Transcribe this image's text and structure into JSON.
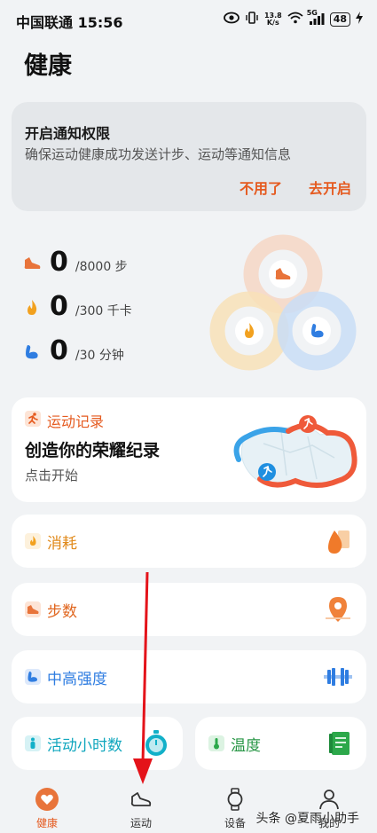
{
  "status_bar": {
    "carrier_time": "中国联通 15:56",
    "net_speed_value": "13.8",
    "net_speed_unit": "K/s",
    "signal": "5G",
    "battery": "48"
  },
  "page": {
    "title": "健康"
  },
  "notice": {
    "title": "开启通知权限",
    "description": "确保运动健康成功发送计步、运动等通知信息",
    "dismiss_label": "不用了",
    "enable_label": "去开启"
  },
  "stats": [
    {
      "icon": "shoe-icon",
      "value": "0",
      "goal": "/8000 步",
      "color": "#e8743b"
    },
    {
      "icon": "flame-icon",
      "value": "0",
      "goal": "/300 千卡",
      "color": "#f2a11f"
    },
    {
      "icon": "arm-icon",
      "value": "0",
      "goal": "/30 分钟",
      "color": "#2f7de1"
    }
  ],
  "record": {
    "tag": "运动记录",
    "title": "创造你的荣耀纪录",
    "subtitle": "点击开始"
  },
  "metrics": {
    "calories": "消耗",
    "steps": "步数",
    "intensity": "中高强度",
    "active_hours": "活动小时数",
    "temperature": "温度"
  },
  "tabs": [
    {
      "label": "健康",
      "icon": "heart-icon",
      "active": true
    },
    {
      "label": "运动",
      "icon": "shoe-icon",
      "active": false
    },
    {
      "label": "设备",
      "icon": "watch-icon",
      "active": false
    },
    {
      "label": "我的",
      "icon": "person-icon",
      "active": false
    }
  ],
  "watermark": "头条 @夏雨小助手",
  "colors": {
    "accent": "#e55a1f",
    "background": "#f1f3f5",
    "calorie": "#f2a11f",
    "intensity": "#2f7de1",
    "active": "#12b0c8",
    "temperature": "#2ca84a"
  }
}
